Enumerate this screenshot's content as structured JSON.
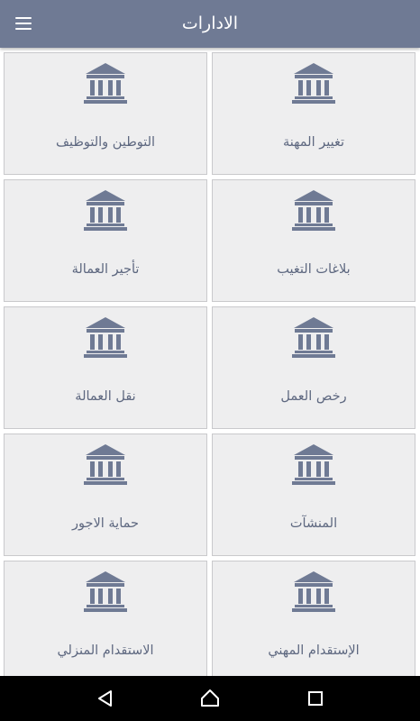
{
  "header": {
    "title": "الادارات",
    "menu_icon": "hamburger-menu-icon"
  },
  "colors": {
    "app_bar": "#6f7a94",
    "tile_bg": "#eeeeef",
    "tile_border": "#c9c9cc",
    "icon": "#6f7a94",
    "label": "#5e6880"
  },
  "tiles": [
    {
      "label": "تغيير المهنة",
      "icon": "government-building-icon"
    },
    {
      "label": "التوطين والتوظيف",
      "icon": "government-building-icon"
    },
    {
      "label": "بلاغات التغيب",
      "icon": "government-building-icon"
    },
    {
      "label": "تأجير العمالة",
      "icon": "government-building-icon"
    },
    {
      "label": "رخص العمل",
      "icon": "government-building-icon"
    },
    {
      "label": "نقل العمالة",
      "icon": "government-building-icon"
    },
    {
      "label": "المنشآت",
      "icon": "government-building-icon"
    },
    {
      "label": "حماية الاجور",
      "icon": "government-building-icon"
    },
    {
      "label": "الإستقدام المهني",
      "icon": "government-building-icon"
    },
    {
      "label": "الاستقدام المنزلي",
      "icon": "government-building-icon"
    }
  ],
  "nav_bar": {
    "back": "back-triangle-icon",
    "home": "home-icon",
    "recents": "recents-square-icon"
  }
}
